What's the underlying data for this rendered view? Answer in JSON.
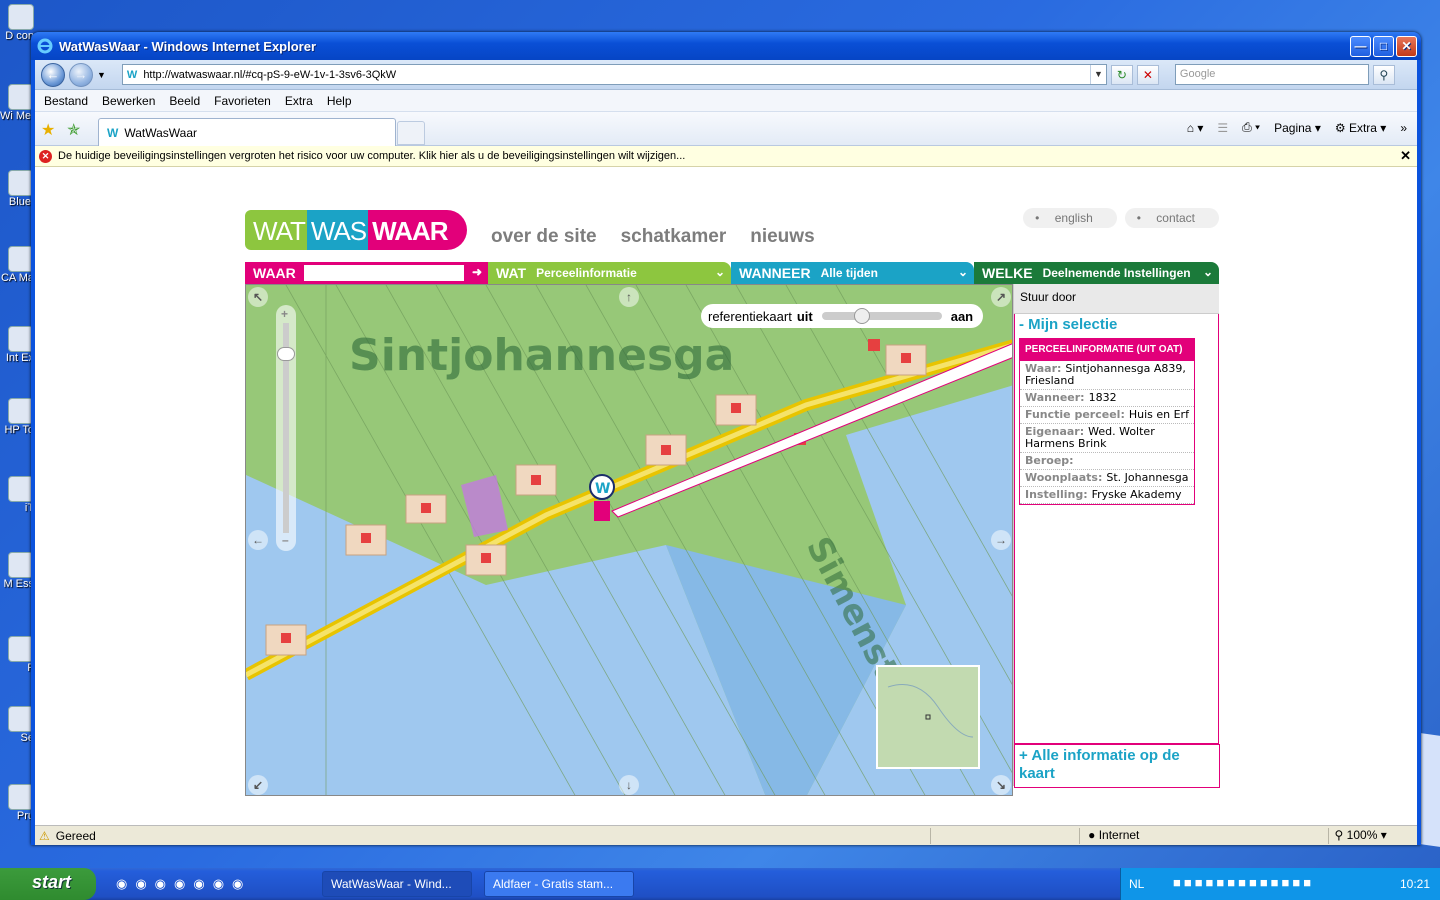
{
  "desktop": {
    "icons": [
      "D con",
      "Wi Medi",
      "Bluet",
      "CA Ma",
      "Int Ex",
      "HP To",
      "iT",
      "M Ess",
      "F",
      "Se",
      "Pru"
    ]
  },
  "window": {
    "title": "WatWasWaar - Windows Internet Explorer",
    "url": "http://watwaswaar.nl/#cq-pS-9-eW-1v-1-3sv6-3QkW",
    "search_placeholder": "Google",
    "menu": [
      "Bestand",
      "Bewerken",
      "Beeld",
      "Favorieten",
      "Extra",
      "Help"
    ],
    "tab_title": "WatWasWaar",
    "cmd_pagina": "Pagina",
    "cmd_extra": "Extra",
    "infobar": "De huidige beveiligingsinstellingen vergroten het risico voor uw computer. Klik hier als u de beveiligingsinstellingen wilt wijzigen...",
    "status": "Gereed",
    "zone": "Internet",
    "zoom": "100%"
  },
  "site": {
    "logo": {
      "a": "WAT",
      "b": "WAS",
      "c": "WAAR"
    },
    "nav": [
      "over de site",
      "schatkamer",
      "nieuws"
    ],
    "top_links": [
      "english",
      "contact"
    ],
    "filters": {
      "waar_label": "WAAR",
      "wat_label": "WAT",
      "wat_value": "Perceelinformatie",
      "wanneer_label": "WANNEER",
      "wanneer_value": "Alle tijden",
      "welke_label": "WELKE",
      "welke_value": "Deelnemende Instellingen"
    },
    "colors": {
      "waar": "#e2007a",
      "wat": "#8dc63f",
      "wanneer": "#1ba3c6",
      "welke": "#1b7a3a"
    },
    "map": {
      "place_label": "Sintjohannesga",
      "street_label": "Simenst",
      "refkaart_label": "referentiekaart",
      "refkaart_off": "uit",
      "refkaart_on": "aan",
      "pin_letter": "W"
    },
    "panel": {
      "stuur_door": "Stuur door",
      "mijn_selectie": "- Mijn selectie",
      "card_title": "PERCEELINFORMATIE (UIT OAT)",
      "rows": [
        {
          "k": "Waar:",
          "v": "Sintjohannesga A839, Friesland"
        },
        {
          "k": "Wanneer:",
          "v": "1832"
        },
        {
          "k": "Functie perceel:",
          "v": "Huis en Erf"
        },
        {
          "k": "Eigenaar:",
          "v": "Wed. Wolter Harmens Brink"
        },
        {
          "k": "Beroep:",
          "v": ""
        },
        {
          "k": "Woonplaats:",
          "v": "St. Johannesga"
        },
        {
          "k": "Instelling:",
          "v": "Fryske Akademy"
        }
      ],
      "alle_info": "+ Alle informatie op de kaart"
    }
  },
  "taskbar": {
    "start": "start",
    "tasks": [
      "WatWasWaar - Wind...",
      "Aldfaer - Gratis stam..."
    ],
    "lang": "NL",
    "clock": "10:21"
  }
}
